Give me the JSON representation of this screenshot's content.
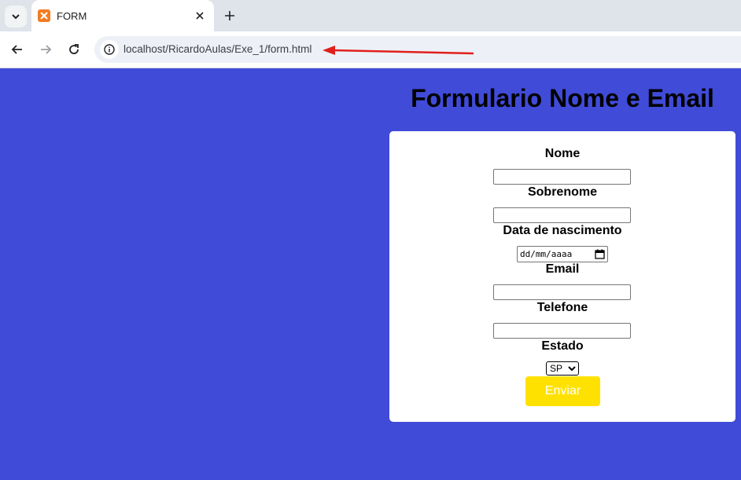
{
  "browser": {
    "tab_title": "FORM",
    "url": "localhost/RicardoAulas/Exe_1/form.html"
  },
  "page": {
    "title": "Formulario Nome e Email",
    "fields": [
      {
        "label": "Nome",
        "value": ""
      },
      {
        "label": "Sobrenome",
        "value": ""
      },
      {
        "label": "Data de nascimento",
        "placeholder": "dd/mm/aaaa"
      },
      {
        "label": "Email",
        "value": ""
      },
      {
        "label": "Telefone",
        "value": ""
      },
      {
        "label": "Estado",
        "selected": "SP"
      }
    ],
    "submit_label": "Enviar"
  },
  "colors": {
    "background": "#404bd8",
    "card": "#ffffff",
    "submit_button": "#ffe100",
    "annotation_arrow": "#e0201b"
  }
}
